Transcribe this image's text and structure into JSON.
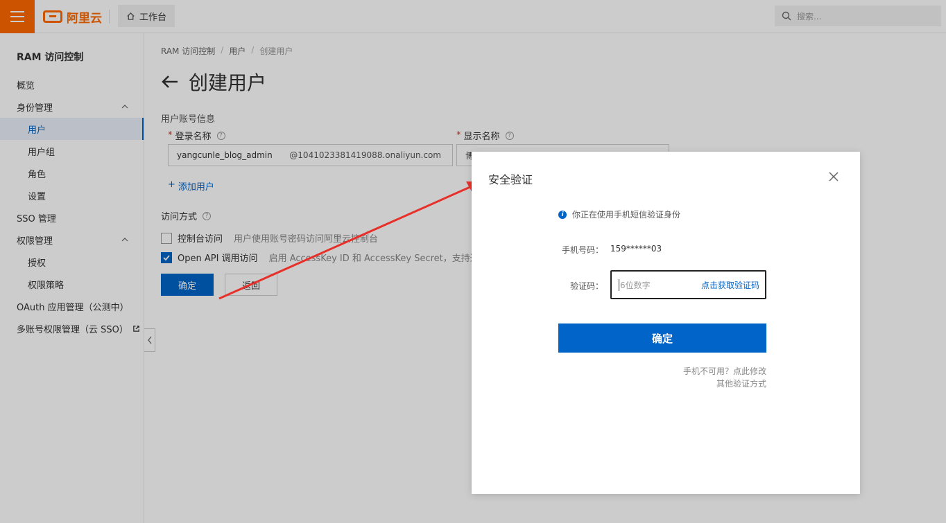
{
  "topbar": {
    "logo_text": "阿里云",
    "workbench_label": "工作台",
    "search_placeholder": "搜索..."
  },
  "sidebar": {
    "title": "RAM 访问控制",
    "items": [
      {
        "label": "概览"
      },
      {
        "label": "身份管理"
      },
      {
        "label": "用户"
      },
      {
        "label": "用户组"
      },
      {
        "label": "角色"
      },
      {
        "label": "设置"
      },
      {
        "label": "SSO 管理"
      },
      {
        "label": "权限管理"
      },
      {
        "label": "授权"
      },
      {
        "label": "权限策略"
      },
      {
        "label": "OAuth 应用管理（公测中）"
      },
      {
        "label": "多账号权限管理（云 SSO）"
      }
    ]
  },
  "main": {
    "breadcrumb": [
      "RAM 访问控制",
      "用户",
      "创建用户"
    ],
    "breadcrumb_sep": "/",
    "page_title": "创建用户",
    "account_section": "用户账号信息",
    "login_name_label": "登录名称",
    "display_name_label": "显示名称",
    "login_name_value": "yangcunle_blog_admin",
    "login_domain": "@1041023381419088.onaliyun.com",
    "display_name_value": "博",
    "add_user": "添加用户",
    "access_section": "访问方式",
    "console_access_label": "控制台访问",
    "console_access_desc": "用户使用账号密码访问阿里云控制台",
    "console_access_checked": false,
    "api_access_label": "Open API 调用访问",
    "api_access_desc": "启用 AccessKey ID 和 AccessKey Secret，支持通过 API 或其",
    "api_access_checked": true,
    "confirm_button": "确定",
    "back_button": "返回"
  },
  "dialog": {
    "title": "安全验证",
    "info_text": "你正在使用手机短信验证身份",
    "phone_label": "手机号码：",
    "phone_value": "159******03",
    "code_label": "验证码：",
    "code_placeholder": "6位数字",
    "get_code_link": "点击获取验证码",
    "confirm_button": "确定",
    "phone_unavailable_link": "手机不可用？点此修改",
    "other_methods_link": "其他验证方式"
  },
  "colors": {
    "brand": "#ff6a00",
    "primary": "#0064c8",
    "annotation_arrow": "#e8302a"
  }
}
